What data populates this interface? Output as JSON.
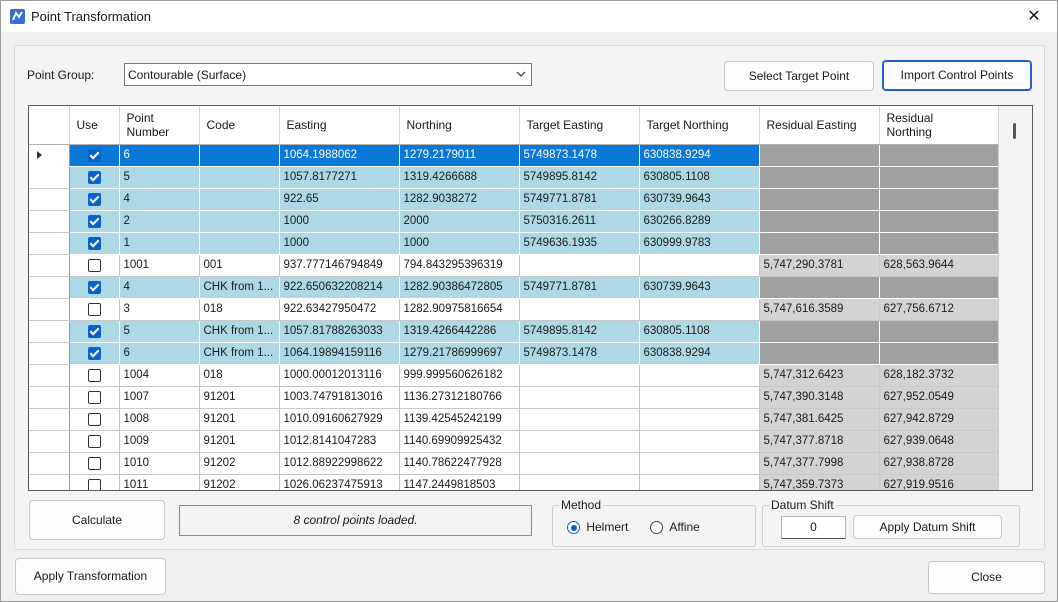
{
  "window": {
    "title": "Point Transformation",
    "close_glyph": "✕",
    "icon": "app-logo-icon"
  },
  "point_group": {
    "label": "Point Group:",
    "value": "Contourable (Surface)"
  },
  "buttons": {
    "select_target": "Select Target Point",
    "import_control": "Import Control Points",
    "calculate": "Calculate",
    "apply_datum": "Apply Datum Shift",
    "apply_transformation": "Apply Transformation",
    "close": "Close"
  },
  "table": {
    "columns": [
      "Use",
      "Point\nNumber",
      "Code",
      "Easting",
      "Northing",
      "Target Easting",
      "Target Northing",
      "Residual Easting",
      "Residual\nNorthing"
    ],
    "rows": [
      {
        "use": true,
        "type": "sel",
        "num": "6",
        "code": "",
        "easting": "1064.1988062",
        "northing": "1279.2179011",
        "te": "5749873.1478",
        "tn": "630838.9294",
        "re": "",
        "rn": ""
      },
      {
        "use": true,
        "type": "ctrl",
        "num": "5",
        "code": "",
        "easting": "1057.8177271",
        "northing": "1319.4266688",
        "te": "5749895.8142",
        "tn": "630805.1108",
        "re": "",
        "rn": ""
      },
      {
        "use": true,
        "type": "ctrl",
        "num": "4",
        "code": "",
        "easting": "922.65",
        "northing": "1282.9038272",
        "te": "5749771.8781",
        "tn": "630739.9643",
        "re": "",
        "rn": ""
      },
      {
        "use": true,
        "type": "ctrl",
        "num": "2",
        "code": "",
        "easting": "1000",
        "northing": "2000",
        "te": "5750316.2611",
        "tn": "630266.8289",
        "re": "",
        "rn": ""
      },
      {
        "use": true,
        "type": "ctrl",
        "num": "1",
        "code": "",
        "easting": "1000",
        "northing": "1000",
        "te": "5749636.1935",
        "tn": "630999.9783",
        "re": "",
        "rn": ""
      },
      {
        "use": false,
        "type": "plain",
        "num": "1001",
        "code": "001",
        "easting": "937.777146794849",
        "northing": "794.843295396319",
        "te": "",
        "tn": "",
        "re": "5,747,290.3781",
        "rn": "628,563.9644"
      },
      {
        "use": true,
        "type": "ctrl",
        "num": "4",
        "code": "CHK from 1...",
        "easting": "922.650632208214",
        "northing": "1282.90386472805",
        "te": "5749771.8781",
        "tn": "630739.9643",
        "re": "",
        "rn": ""
      },
      {
        "use": false,
        "type": "plain",
        "num": "3",
        "code": "018",
        "easting": "922.63427950472",
        "northing": "1282.90975816654",
        "te": "",
        "tn": "",
        "re": "5,747,616.3589",
        "rn": "627,756.6712"
      },
      {
        "use": true,
        "type": "ctrl",
        "num": "5",
        "code": "CHK from 1...",
        "easting": "1057.81788263033",
        "northing": "1319.4266442286",
        "te": "5749895.8142",
        "tn": "630805.1108",
        "re": "",
        "rn": ""
      },
      {
        "use": true,
        "type": "ctrl",
        "num": "6",
        "code": "CHK from 1...",
        "easting": "1064.19894159116",
        "northing": "1279.21786999697",
        "te": "5749873.1478",
        "tn": "630838.9294",
        "re": "",
        "rn": ""
      },
      {
        "use": false,
        "type": "plain",
        "num": "1004",
        "code": "018",
        "easting": "1000.00012013116",
        "northing": "999.999560626182",
        "te": "",
        "tn": "",
        "re": "5,747,312.6423",
        "rn": "628,182.3732"
      },
      {
        "use": false,
        "type": "plain",
        "num": "1007",
        "code": "91201",
        "easting": "1003.74791813016",
        "northing": "1136.27312180766",
        "te": "",
        "tn": "",
        "re": "5,747,390.3148",
        "rn": "627,952.0549"
      },
      {
        "use": false,
        "type": "plain",
        "num": "1008",
        "code": "91201",
        "easting": "1010.09160627929",
        "northing": "1139.42545242199",
        "te": "",
        "tn": "",
        "re": "5,747,381.6425",
        "rn": "627,942.8729"
      },
      {
        "use": false,
        "type": "plain",
        "num": "1009",
        "code": "91201",
        "easting": "1012.8141047283",
        "northing": "1140.69909925432",
        "te": "",
        "tn": "",
        "re": "5,747,377.8718",
        "rn": "627,939.0648"
      },
      {
        "use": false,
        "type": "plain",
        "num": "1010",
        "code": "91202",
        "easting": "1012.88922998622",
        "northing": "1140.78622477928",
        "te": "",
        "tn": "",
        "re": "5,747,377.7998",
        "rn": "627,938.8728"
      },
      {
        "use": false,
        "type": "plain",
        "num": "1011",
        "code": "91202",
        "easting": "1026.06237475913",
        "northing": "1147.2449818503",
        "te": "",
        "tn": "",
        "re": "5,747,359.7373",
        "rn": "627,919.9516"
      }
    ]
  },
  "status": "8 control points loaded.",
  "method": {
    "title": "Method",
    "options": [
      "Helmert",
      "Affine"
    ],
    "selected": "Helmert"
  },
  "datum_shift": {
    "title": "Datum Shift",
    "value": "0"
  }
}
